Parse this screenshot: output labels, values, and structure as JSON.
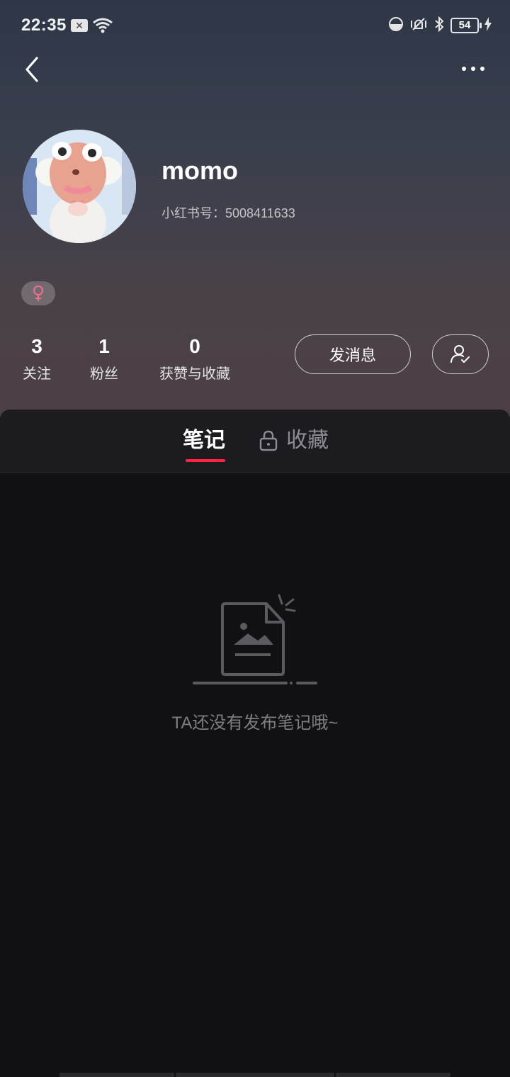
{
  "status_bar": {
    "time": "22:35",
    "notification_icon": "x-icon",
    "battery": "54"
  },
  "nav": {
    "back_icon": "chevron-left-icon",
    "more_icon": "more-dots-icon"
  },
  "profile": {
    "username": "momo",
    "id_label": "小红书号：",
    "id_value": "5008411633",
    "gender_icon": "female-icon",
    "gender_color": "#f0708a"
  },
  "stats": [
    {
      "value": "3",
      "label": "关注"
    },
    {
      "value": "1",
      "label": "粉丝"
    },
    {
      "value": "0",
      "label": "获赞与收藏"
    }
  ],
  "actions": {
    "message_label": "发消息",
    "follow_icon": "user-check-icon"
  },
  "tabs": [
    {
      "label": "笔记",
      "active": true
    },
    {
      "label": "收藏",
      "locked": true
    }
  ],
  "accent_color": "#ff2442",
  "empty_state": {
    "icon": "empty-document-icon",
    "text": "TA还没有发布笔记哦~"
  }
}
